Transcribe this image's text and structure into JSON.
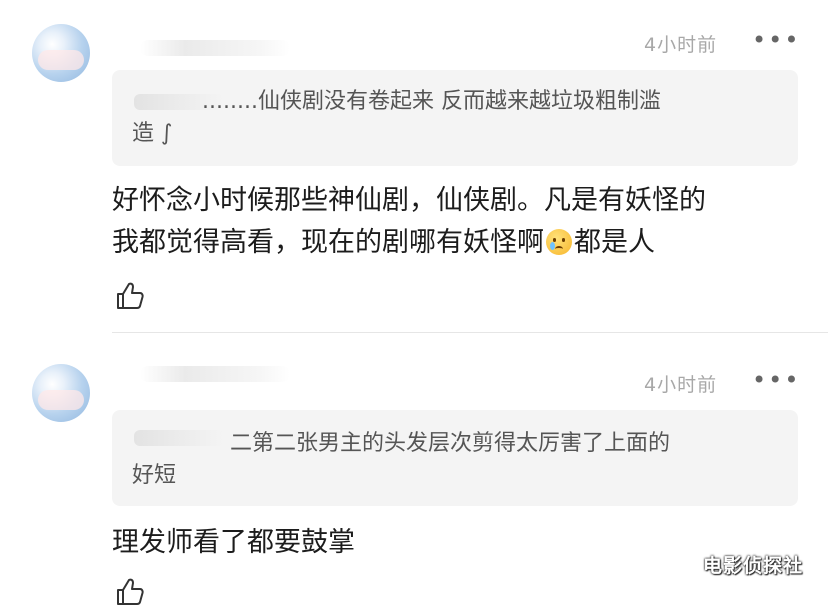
{
  "comments": [
    {
      "time": "4小时前",
      "more_icon": "more-dots-icon",
      "quote_line1": "........仙侠剧没有卷起来 反而越来越垃圾粗制滥",
      "quote_line2": "造 ∫",
      "text_line1": "好怀念小时候那些神仙剧，仙侠剧。凡是有妖怪的",
      "text_line2_a": "我都觉得高看，现在的剧哪有妖怪啊",
      "emoji_icon": "crying-face-emoji-icon",
      "text_line2_b": "都是人",
      "like_icon": "thumbs-up-icon"
    },
    {
      "time": "4小时前",
      "more_icon": "more-dots-icon",
      "quote_line1": "二第二张男主的头发层次剪得太厉害了上面的",
      "quote_line2": "好短",
      "text_line1": "理发师看了都要鼓掌",
      "like_icon": "thumbs-up-icon"
    }
  ],
  "watermark": "电影侦探社"
}
